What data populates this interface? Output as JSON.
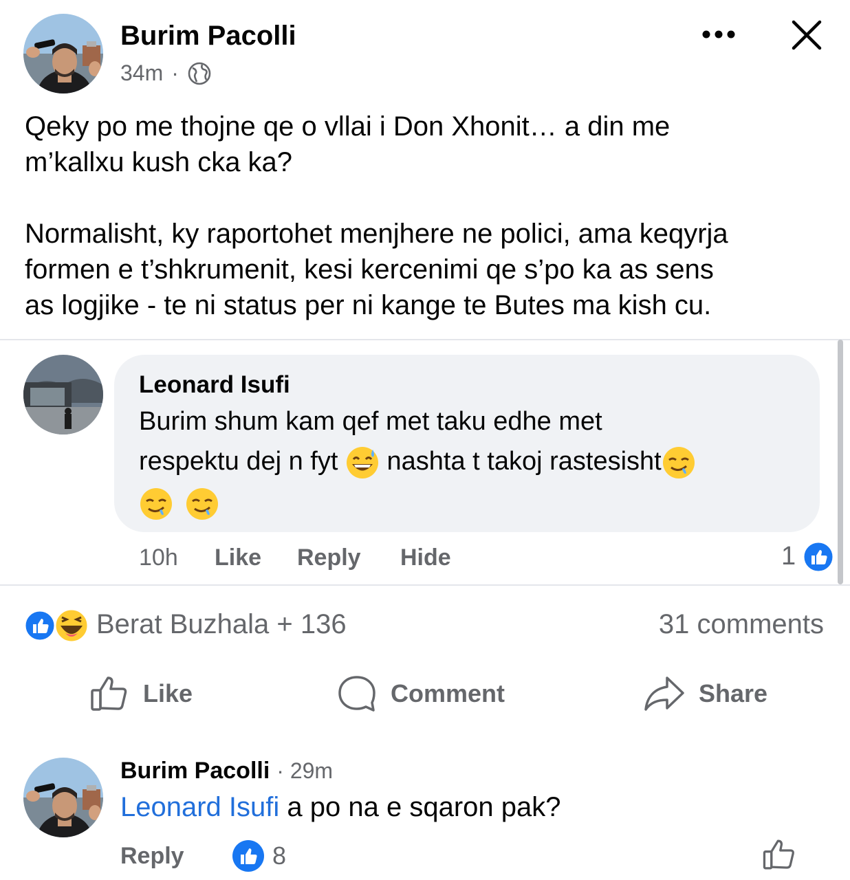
{
  "post": {
    "author": "Burim Pacolli",
    "time": "34m",
    "separator": "·",
    "text_p1": "Qeky po me thojne qe o vllai i Don Xhonit… a din me\nm’kallxu kush cka ka?",
    "text_p2": "Normalisht, ky raportohet menjhere ne polici, ama keqyrja\nformen e t’shkrumenit, kesi kercenimi qe s’po ka as sens\nas logjike  - te ni status per ni kange te Butes ma kish cu."
  },
  "embedded_comment": {
    "author": "Leonard Isufi",
    "text_line1": "Burim shum kam qef met taku edhe met",
    "text_line2a": "respektu dej n fyt",
    "text_line2b": "nashta t takoj rastesisht",
    "time": "10h",
    "like": "Like",
    "reply": "Reply",
    "hide": "Hide",
    "reaction_count": "1"
  },
  "reactions": {
    "summary": "Berat Buzhala + 136",
    "comments": "31 comments"
  },
  "actions": {
    "like": "Like",
    "comment": "Comment",
    "share": "Share"
  },
  "reply_comment": {
    "author": "Burim Pacolli",
    "time": "· 29m",
    "mention": "Leonard Isufi",
    "text": " a po na e sqaron pak?",
    "reply": "Reply",
    "like_count": "8"
  },
  "colors": {
    "facebook_blue": "#1877f2",
    "link_blue": "#216fdb",
    "secondary_text": "#65676b",
    "bubble_bg": "#f0f2f5"
  }
}
